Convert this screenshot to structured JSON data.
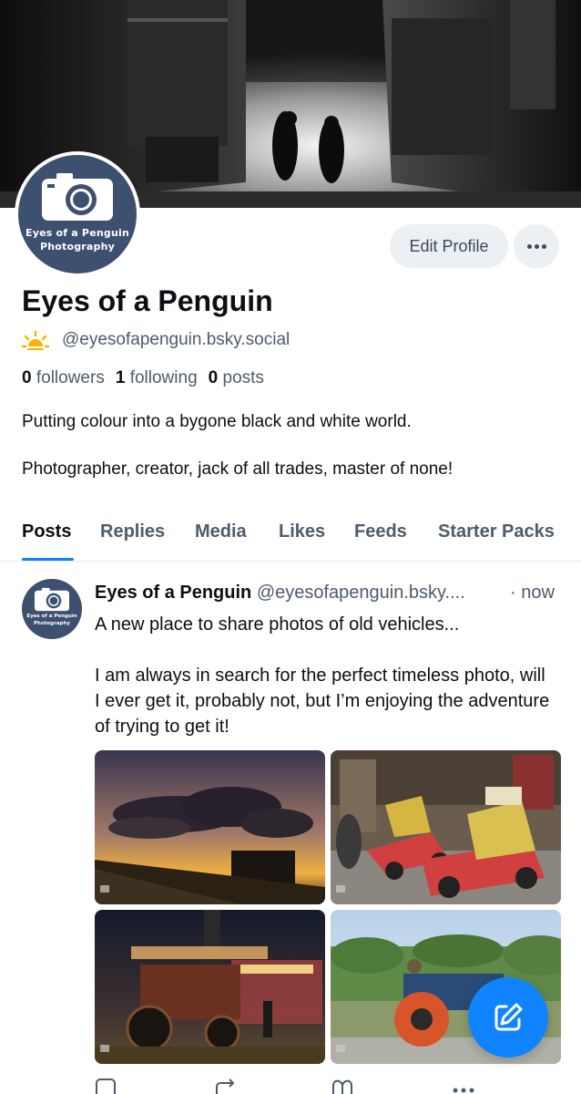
{
  "profile": {
    "display_name": "Eyes of a Penguin",
    "handle": "@eyesofapenguin.bsky.social",
    "status_icon": "sun-icon",
    "brand_line1": "Eyes of a Penguin",
    "brand_line2": "Photography",
    "followers_count": "0",
    "followers_label": "followers",
    "following_count": "1",
    "following_label": "following",
    "posts_count": "0",
    "posts_label": "posts",
    "bio_line1": "Putting colour into a bygone black and white world.",
    "bio_line2": "Photographer, creator, jack of all trades, master of none!"
  },
  "buttons": {
    "edit_profile": "Edit Profile",
    "more_icon": "ellipsis-icon"
  },
  "tabs": [
    {
      "label": "Posts",
      "active": true
    },
    {
      "label": "Replies",
      "active": false
    },
    {
      "label": "Media",
      "active": false
    },
    {
      "label": "Likes",
      "active": false
    },
    {
      "label": "Feeds",
      "active": false
    },
    {
      "label": "Starter Packs",
      "active": false
    }
  ],
  "post": {
    "author": "Eyes of a Penguin",
    "handle": "@eyesofapenguin.bsky....",
    "time": "· now",
    "text_p1": "A new place to share photos of old vehicles...",
    "text_p2": "I am always in search for the perfect timeless photo, will I ever get it, probably not, but I’m enjoying the adventure of trying to get it!",
    "images": [
      {
        "subject": "steam locomotive at sunset"
      },
      {
        "subject": "stock car in workshop"
      },
      {
        "subject": "traction engine at night"
      },
      {
        "subject": "blue tractor with orange wheels"
      }
    ]
  },
  "actions": [
    "reply-icon",
    "repost-icon",
    "like-icon",
    "more-icon"
  ],
  "fab_icon": "compose-icon",
  "colors": {
    "accent": "#1083fe",
    "avatar_bg": "#3d5070",
    "muted_text": "#4d5b6b"
  }
}
